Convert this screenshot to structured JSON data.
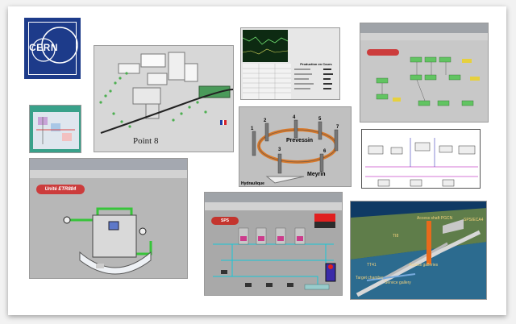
{
  "logo": {
    "text": "CERN"
  },
  "point8": {
    "caption": "Point 8"
  },
  "chart_panel": {
    "production_title": "Production en Cours"
  },
  "hydraulics": {
    "prevessin_label": "Prevessin",
    "meyrin_label": "Meyrin",
    "hydro_label": "Hydraulique",
    "numbers": [
      "1",
      "2",
      "3",
      "4",
      "5",
      "6",
      "7"
    ]
  },
  "etr": {
    "title": "Unité ETR884"
  },
  "sps": {
    "title": "SPS"
  },
  "tunnel": {
    "labels": [
      "Access shaft PGCN",
      "SPS/ECA4",
      "TI8",
      "TT41",
      "Access galleries",
      "Service gallery",
      "Target chamber"
    ]
  },
  "colors": {
    "cern_blue": "#1d3b8a",
    "scada_teal": "#39a18a",
    "alarm_red": "#cc3c3c",
    "tunnel_blue": "#174b7a",
    "access_shaft_orange": "#e86a1c"
  }
}
